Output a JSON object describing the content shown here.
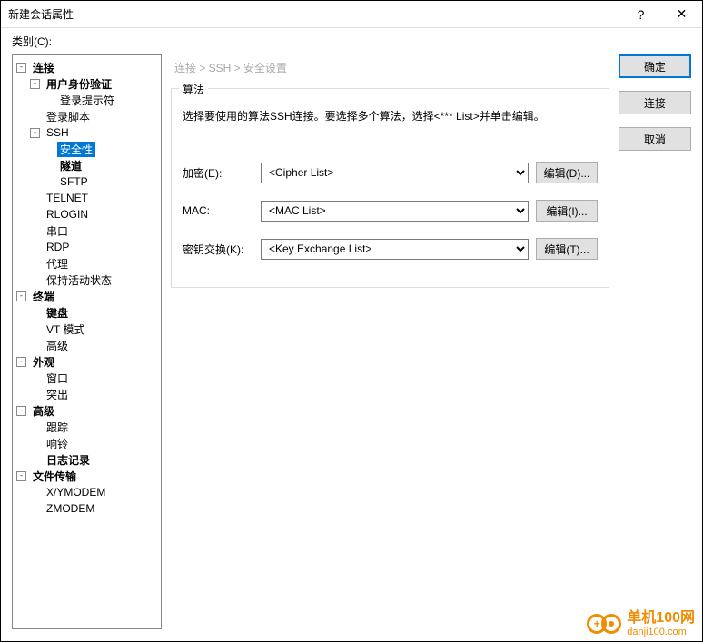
{
  "window": {
    "title": "新建会话属性",
    "help": "?",
    "close": "✕"
  },
  "category_label": "类别(C):",
  "tree": [
    {
      "indent": 0,
      "toggle": "-",
      "label": "连接",
      "bold": true
    },
    {
      "indent": 1,
      "toggle": "-",
      "label": "用户身份验证",
      "bold": true
    },
    {
      "indent": 2,
      "toggle": "",
      "label": "登录提示符"
    },
    {
      "indent": 1,
      "toggle": "",
      "label": "登录脚本"
    },
    {
      "indent": 1,
      "toggle": "-",
      "label": "SSH"
    },
    {
      "indent": 2,
      "toggle": "",
      "label": "安全性",
      "selected": true
    },
    {
      "indent": 2,
      "toggle": "",
      "label": "隧道",
      "bold": true
    },
    {
      "indent": 2,
      "toggle": "",
      "label": "SFTP"
    },
    {
      "indent": 1,
      "toggle": "",
      "label": "TELNET"
    },
    {
      "indent": 1,
      "toggle": "",
      "label": "RLOGIN"
    },
    {
      "indent": 1,
      "toggle": "",
      "label": "串口"
    },
    {
      "indent": 1,
      "toggle": "",
      "label": "RDP"
    },
    {
      "indent": 1,
      "toggle": "",
      "label": "代理"
    },
    {
      "indent": 1,
      "toggle": "",
      "label": "保持活动状态"
    },
    {
      "indent": 0,
      "toggle": "-",
      "label": "终端",
      "bold": true
    },
    {
      "indent": 1,
      "toggle": "",
      "label": "键盘",
      "bold": true
    },
    {
      "indent": 1,
      "toggle": "",
      "label": "VT 模式"
    },
    {
      "indent": 1,
      "toggle": "",
      "label": "高级"
    },
    {
      "indent": 0,
      "toggle": "-",
      "label": "外观",
      "bold": true
    },
    {
      "indent": 1,
      "toggle": "",
      "label": "窗口"
    },
    {
      "indent": 1,
      "toggle": "",
      "label": "突出"
    },
    {
      "indent": 0,
      "toggle": "-",
      "label": "高级",
      "bold": true
    },
    {
      "indent": 1,
      "toggle": "",
      "label": "跟踪"
    },
    {
      "indent": 1,
      "toggle": "",
      "label": "响铃"
    },
    {
      "indent": 1,
      "toggle": "",
      "label": "日志记录",
      "bold": true
    },
    {
      "indent": 0,
      "toggle": "-",
      "label": "文件传输",
      "bold": true
    },
    {
      "indent": 1,
      "toggle": "",
      "label": "X/YMODEM"
    },
    {
      "indent": 1,
      "toggle": "",
      "label": "ZMODEM"
    }
  ],
  "breadcrumb": "连接 > SSH > 安全设置",
  "group": {
    "title": "算法",
    "help": "选择要使用的算法SSH连接。要选择多个算法，选择<*** List>并单击编辑。",
    "rows": [
      {
        "label": "加密(E):",
        "value": "<Cipher List>",
        "btn": "编辑(D)..."
      },
      {
        "label": "MAC:",
        "value": "<MAC List>",
        "btn": "编辑(I)..."
      },
      {
        "label": "密钥交换(K):",
        "value": "<Key Exchange List>",
        "btn": "编辑(T)..."
      }
    ]
  },
  "buttons": {
    "ok": "确定",
    "connect": "连接",
    "cancel": "取消"
  },
  "watermark": {
    "zh": "单机100网",
    "url": "danji100.com"
  }
}
